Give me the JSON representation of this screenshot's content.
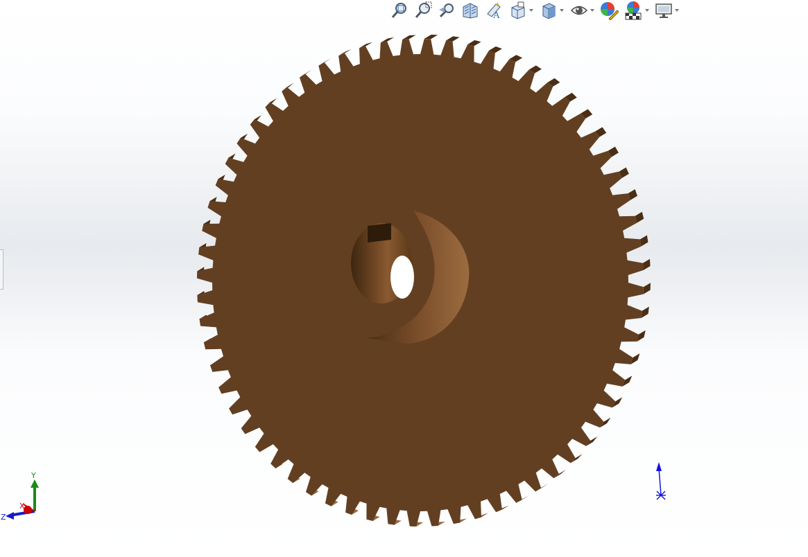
{
  "toolbar": {
    "items": [
      {
        "name": "zoom-to-fit",
        "icon": "zoom-to-fit-icon",
        "dropdown": false
      },
      {
        "name": "zoom-to-area",
        "icon": "zoom-to-area-icon",
        "dropdown": false
      },
      {
        "name": "previous-view",
        "icon": "previous-view-icon",
        "dropdown": false
      },
      {
        "name": "section-view",
        "icon": "section-view-icon",
        "dropdown": false
      },
      {
        "name": "dynamic-annotation-views",
        "icon": "dynamic-annotation-icon",
        "dropdown": false
      },
      {
        "name": "view-orientation",
        "icon": "view-orientation-icon",
        "dropdown": true
      },
      {
        "name": "display-style",
        "icon": "display-style-icon",
        "dropdown": true
      },
      {
        "name": "hide-show-items",
        "icon": "eye-icon",
        "dropdown": true
      },
      {
        "name": "edit-appearance",
        "icon": "edit-appearance-icon",
        "dropdown": false
      },
      {
        "name": "apply-scene",
        "icon": "apply-scene-icon",
        "dropdown": true
      },
      {
        "name": "view-settings",
        "icon": "monitor-icon",
        "dropdown": true
      }
    ]
  },
  "triad": {
    "x_label": "X",
    "y_label": "Y",
    "z_label": "Z"
  },
  "colors": {
    "gear_face": "#633f22",
    "gear_tooth_side": "#4a2e15",
    "gear_tooth_top": "#9a6a3e",
    "axis_x": "#cc0000",
    "axis_y": "#1a8c1a",
    "axis_z": "#1a1acc",
    "reference_triad": "#1111dd"
  },
  "model": {
    "part": "spur gear",
    "teeth": 64
  }
}
